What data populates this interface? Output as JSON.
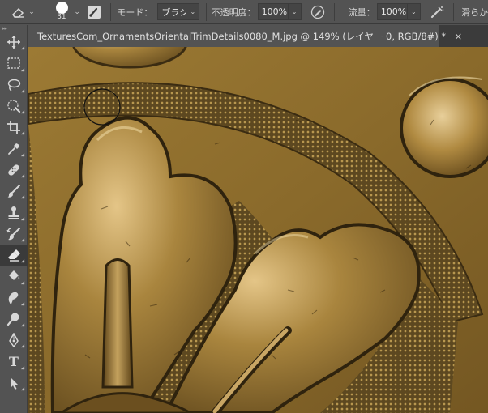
{
  "options_bar": {
    "brush_size": "31",
    "mode_label": "モード：",
    "mode_value": "ブラシ",
    "opacity_label": "不透明度：",
    "opacity_value": "100%",
    "flow_label": "流量：",
    "flow_value": "100%",
    "smoothing_label": "滑らか"
  },
  "document": {
    "tab_title": "TexturesCom_OrnamentsOrientalTrimDetails0080_M.jpg @ 149% (レイヤー 0, RGB/8#) *",
    "close_glyph": "×"
  },
  "toolbar": {
    "collapse_glyph": "▸▸",
    "type_tool_glyph": "T",
    "tools": [
      "move-tool",
      "marquee-tool",
      "lasso-tool",
      "quick-selection-tool",
      "crop-tool",
      "eyedropper-tool",
      "healing-brush-tool",
      "brush-tool",
      "clone-stamp-tool",
      "history-brush-tool",
      "eraser-tool",
      "paint-bucket-tool",
      "smudge-tool",
      "dodge-tool",
      "pen-tool",
      "type-tool",
      "path-selection-tool"
    ],
    "active_tool": "eraser-tool"
  },
  "colors": {
    "ui_panel": "#535353",
    "ui_dark": "#3b3b3b",
    "metal_base": "#8e6d2c",
    "metal_highlight": "#d9b978",
    "metal_shadow": "#3b2c12"
  }
}
